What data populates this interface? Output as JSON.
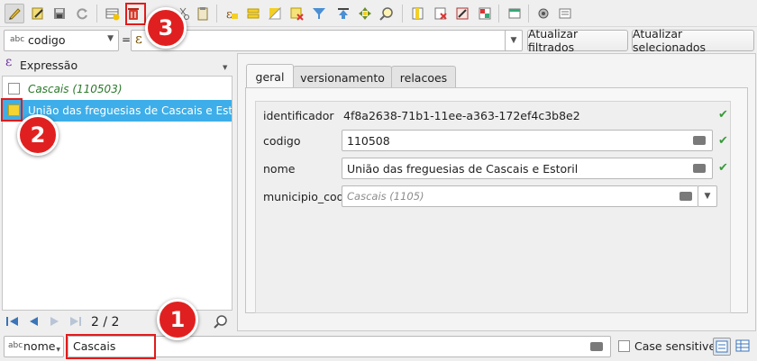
{
  "toolbar": {
    "icons": [
      "pencil-toggle-edit-icon",
      "multi-edit-icon",
      "save-edits-icon",
      "reload-icon",
      "add-feature-icon",
      "delete-feature-icon",
      "cut-icon",
      "copy-icon",
      "paste-icon",
      "expression-select-icon",
      "select-all-icon",
      "invert-selection-icon",
      "deselect-icon",
      "filter-icon",
      "move-selection-top-icon",
      "pan-to-selection-icon",
      "zoom-to-selection-icon",
      "new-field-icon",
      "delete-field-icon",
      "field-calculator-icon",
      "conditional-formatting-icon",
      "dock-icon",
      "actions-icon",
      "form-view-icon"
    ]
  },
  "filter_bar": {
    "field_type_tag": "abc",
    "field_name": "codigo",
    "equals": "=",
    "expression_symbol": "ε",
    "value": "",
    "update_filtered_label": "Atualizar filtrados",
    "update_selected_label": "Atualizar selecionados"
  },
  "left_panel": {
    "header_symbol": "ε",
    "header_label": "Expressão",
    "rows": [
      {
        "label": "Cascais (110503)",
        "checked": false,
        "selected": false
      },
      {
        "label": "União das freguesias de Cascais e Estoril",
        "checked": true,
        "selected": true
      }
    ],
    "pager": "2 / 2"
  },
  "tabs": [
    {
      "label": "geral",
      "active": true
    },
    {
      "label": "versionamento",
      "active": false
    },
    {
      "label": "relacoes",
      "active": false
    }
  ],
  "form": {
    "fields": [
      {
        "label": "identificador",
        "value": "4f8a2638-71b1-11ee-a363-172ef4c3b8e2",
        "placeholder": ""
      },
      {
        "label": "codigo",
        "value": "110508",
        "placeholder": ""
      },
      {
        "label": "nome",
        "value": "União das freguesias de Cascais e Estoril",
        "placeholder": ""
      },
      {
        "label": "municipio_cod",
        "value": "",
        "placeholder": "Cascais (1105)"
      }
    ],
    "check_glyph": "✔"
  },
  "bottom_bar": {
    "field_type_tag": "abc",
    "field_name": "nome",
    "search_value": "Cascais",
    "case_sensitive_label": "Case sensitive"
  },
  "callouts": [
    "1",
    "2",
    "3"
  ],
  "colors": {
    "selection": "#3daee9",
    "callout": "#e02020",
    "highlight": "#e21b1b",
    "valid_check": "#3a9a3a",
    "checked_box": "#f5d330"
  }
}
